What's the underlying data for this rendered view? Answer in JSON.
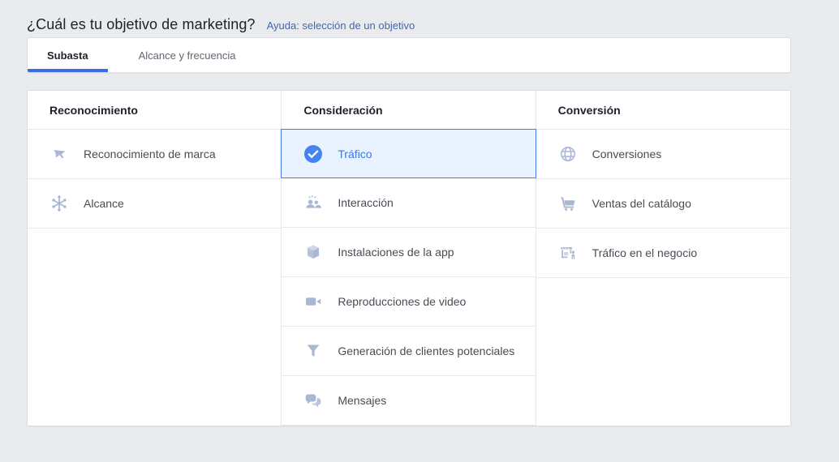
{
  "header": {
    "title": "¿Cuál es tu objetivo de marketing?",
    "help_link": "Ayuda: selección de un objetivo"
  },
  "tabs": [
    {
      "label": "Subasta",
      "active": true
    },
    {
      "label": "Alcance y frecuencia",
      "active": false
    }
  ],
  "objectives": {
    "columns": [
      {
        "header": "Reconocimiento",
        "items": [
          {
            "label": "Reconocimiento de marca",
            "icon": "megaphone-icon",
            "selected": false
          },
          {
            "label": "Alcance",
            "icon": "reach-burst-icon",
            "selected": false
          }
        ]
      },
      {
        "header": "Consideración",
        "items": [
          {
            "label": "Tráfico",
            "icon": "check-circle-icon",
            "selected": true
          },
          {
            "label": "Interacción",
            "icon": "engagement-people-icon",
            "selected": false
          },
          {
            "label": "Instalaciones de la app",
            "icon": "app-cube-icon",
            "selected": false
          },
          {
            "label": "Reproducciones de video",
            "icon": "video-camera-icon",
            "selected": false
          },
          {
            "label": "Generación de clientes potenciales",
            "icon": "lead-funnel-icon",
            "selected": false
          },
          {
            "label": "Mensajes",
            "icon": "chat-bubbles-icon",
            "selected": false
          }
        ]
      },
      {
        "header": "Conversión",
        "items": [
          {
            "label": "Conversiones",
            "icon": "globe-icon",
            "selected": false
          },
          {
            "label": "Ventas del catálogo",
            "icon": "cart-icon",
            "selected": false
          },
          {
            "label": "Tráfico en el negocio",
            "icon": "storefront-icon",
            "selected": false
          }
        ]
      }
    ]
  },
  "colors": {
    "page_background": "#e9ebee",
    "accent_blue": "#3b6be1",
    "selected_border": "#3e7df0",
    "selected_background": "#e9f2fe",
    "selected_text": "#3b78e5",
    "link_blue": "#4267b2",
    "icon_gray_blue": "#a9b7d3",
    "check_circle_blue": "#4583f2"
  }
}
